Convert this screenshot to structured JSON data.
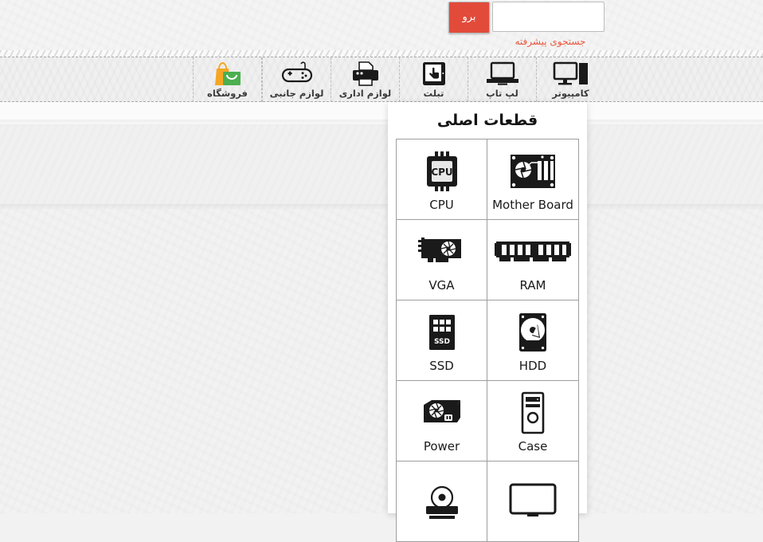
{
  "search": {
    "go_label": "برو",
    "input_value": "",
    "input_placeholder": "",
    "advanced_label": "جستجوی پیشرفته",
    "button_color": "#e24b3a",
    "link_color": "#e8573f"
  },
  "nav": {
    "items": [
      {
        "label": "فروشگاه",
        "icon": "shopping-bags-icon"
      },
      {
        "label": "لوازم جانبی",
        "icon": "gamepad-icon"
      },
      {
        "label": "لوازم اداری",
        "icon": "printer-icon"
      },
      {
        "label": "تبلت",
        "icon": "tablet-icon"
      },
      {
        "label": "لپ تاپ",
        "icon": "laptop-icon"
      },
      {
        "label": "کامپیوتر",
        "icon": "desktop-computer-icon"
      }
    ]
  },
  "panel": {
    "title": "قطعات اصلی",
    "items": [
      {
        "label": "CPU",
        "icon": "cpu-icon"
      },
      {
        "label": "Mother Board",
        "icon": "motherboard-icon"
      },
      {
        "label": "VGA",
        "icon": "vga-card-icon"
      },
      {
        "label": "RAM",
        "icon": "ram-stick-icon"
      },
      {
        "label": "SSD",
        "icon": "ssd-icon"
      },
      {
        "label": "HDD",
        "icon": "hdd-icon"
      },
      {
        "label": "Power",
        "icon": "power-supply-icon"
      },
      {
        "label": "Case",
        "icon": "computer-case-icon"
      },
      {
        "label": "",
        "icon": "optical-drive-icon"
      },
      {
        "label": "",
        "icon": "monitor-icon"
      }
    ]
  }
}
